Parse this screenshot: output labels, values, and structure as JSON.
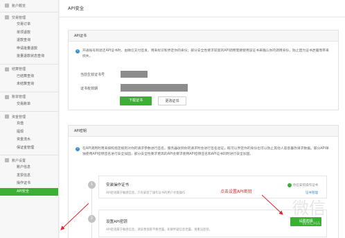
{
  "sidebar": {
    "sections": [
      {
        "label": "账户概览",
        "items": []
      },
      {
        "label": "交易管理",
        "items": [
          "交易订单",
          "单项退款",
          "退款查询",
          "申请批量退款",
          "批量退款状态查询"
        ]
      },
      {
        "label": "结算管理",
        "items": [
          "已结算查询",
          "未结算查询"
        ]
      },
      {
        "label": "账单管理",
        "items": [
          "交易账单"
        ]
      },
      {
        "label": "资金管理",
        "items": [
          "充值",
          "提现",
          "资金流水",
          "保证金管理"
        ]
      },
      {
        "label": "账户设置",
        "items": [
          "账户信息",
          "发票信息",
          "操作证书",
          "API安全"
        ]
      }
    ],
    "active": "API安全"
  },
  "page_title": "API安全",
  "cert": {
    "heading": "API证书",
    "notice": "开通账号和退还API证书时，由微信支付签发，用来标识和界定你的身份；部分安全性要求较高的API调用需要使用该证书来确认你的调用身份，防止因为证书泄露而带来损失。",
    "current_label": "当前生效证书号",
    "expiry_label": "证书有效期",
    "download_label": "下载证书",
    "renew_label": "更改证书"
  },
  "key": {
    "heading": "API密钥",
    "notice": "在API调用时用来按照指定规则对你的请求参数进行签名，服务器收到你的请求时会进行签名验证，既可以界定你的身份也可以防止其他人恶意篡改请求数据。部分API单独使用API密钥签名进行安全加固，部分安全性要求更高的API会要求使用API密钥签名和API证书同时进行安全加固。",
    "steps": [
      {
        "num": "1",
        "title": "安装操作证书",
        "desc": "API密钥属于敏感信息，只有安装了操作证书的用户才能操作",
        "status": "你已安装操作证书",
        "link": "证书管理"
      },
      {
        "num": "2",
        "title": "设置API密钥",
        "desc": "API密钥属于敏感信息，请妥善保管不要泄露，如果怀疑信息泄露，请重设密钥。",
        "button": "设置密钥"
      }
    ]
  },
  "annotation": "点击设置API密钥",
  "watermark": {
    "main": "微信",
    "sub": "WXCHA"
  },
  "colors": {
    "accent": "#3cb035",
    "annotation": "#e0262e",
    "info": "#3a8fd6"
  }
}
